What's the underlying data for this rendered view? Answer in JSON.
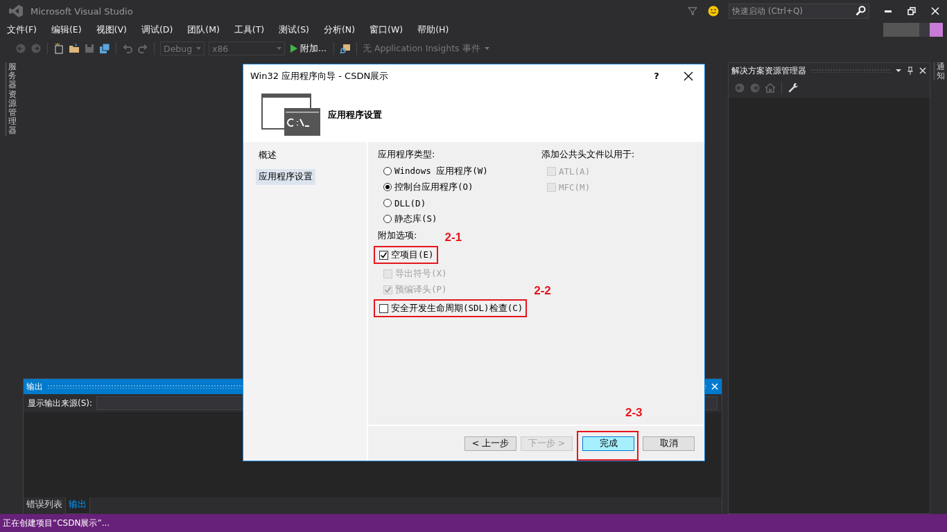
{
  "window": {
    "title": "Microsoft Visual Studio"
  },
  "quick_launch": {
    "placeholder": "快速启动 (Ctrl+Q)"
  },
  "menu": [
    "文件(F)",
    "编辑(E)",
    "视图(V)",
    "调试(D)",
    "团队(M)",
    "工具(T)",
    "测试(S)",
    "分析(N)",
    "窗口(W)",
    "帮助(H)"
  ],
  "toolbar": {
    "configuration": "Debug",
    "platform": "x86",
    "start": "附加...",
    "insights": "无 Application Insights 事件"
  },
  "left_tabs": [
    "服务器资源管理器"
  ],
  "solution_explorer": {
    "title": "解决方案资源管理器"
  },
  "right_tabs": [
    "通知"
  ],
  "output_panel": {
    "title": "输出",
    "source_label": "显示输出来源(S):",
    "tabs": [
      {
        "label": "错误列表",
        "selected": false
      },
      {
        "label": "输出",
        "selected": true
      }
    ]
  },
  "status_bar": {
    "text": "正在创建项目“CSDN展示”..."
  },
  "dialog": {
    "title": "Win32 应用程序向导 - CSDN展示",
    "help": "?",
    "heading": "应用程序设置",
    "nav": [
      {
        "label": "概述",
        "selected": false
      },
      {
        "label": "应用程序设置",
        "selected": true
      }
    ],
    "app_type": {
      "label": "应用程序类型:",
      "options": [
        {
          "label": "Windows 应用程序(W)",
          "selected": false
        },
        {
          "label": "控制台应用程序(O)",
          "selected": true
        },
        {
          "label": "DLL(D)",
          "selected": false
        },
        {
          "label": "静态库(S)",
          "selected": false
        }
      ]
    },
    "extra_options": {
      "label": "附加选项:",
      "options": [
        {
          "label": "空项目(E)",
          "checked": true,
          "disabled": false,
          "annotation": "2-1"
        },
        {
          "label": "导出符号(X)",
          "checked": false,
          "disabled": true
        },
        {
          "label": "预编译头(P)",
          "checked": true,
          "disabled": true
        },
        {
          "label": "安全开发生命周期(SDL)检查(C)",
          "checked": false,
          "disabled": false,
          "annotation": "2-2"
        }
      ]
    },
    "headers": {
      "label": "添加公共头文件以用于:",
      "options": [
        {
          "label": "ATL(A)",
          "checked": false,
          "disabled": true
        },
        {
          "label": "MFC(M)",
          "checked": false,
          "disabled": true
        }
      ]
    },
    "buttons": [
      {
        "label": "< 上一步",
        "disabled": false,
        "default": false
      },
      {
        "label": "下一步 >",
        "disabled": true,
        "default": false
      },
      {
        "label": "完成",
        "disabled": false,
        "default": true,
        "annotation": "2-3"
      },
      {
        "label": "取消",
        "disabled": false,
        "default": false
      }
    ]
  }
}
